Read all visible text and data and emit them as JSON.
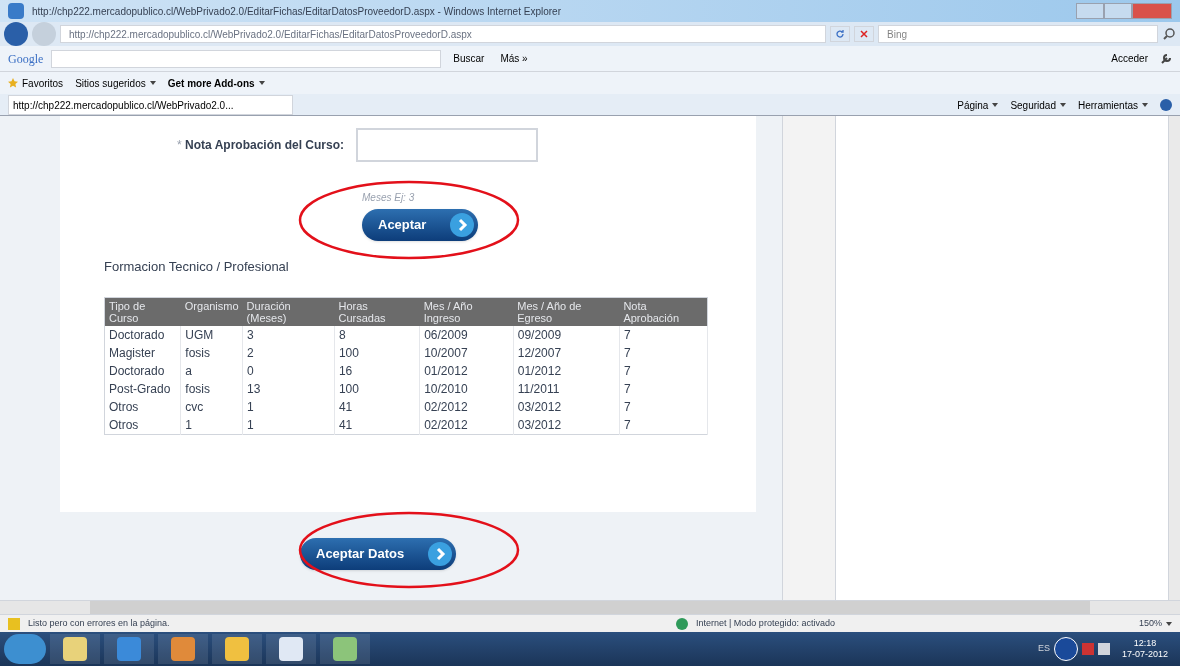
{
  "window": {
    "title": "http://chp222.mercadopublico.cl/WebPrivado2.0/EditarFichas/EditarDatosProveedorD.aspx - Windows Internet Explorer"
  },
  "address_bar": {
    "url": "http://chp222.mercadopublico.cl/WebPrivado2.0/EditarFichas/EditarDatosProveedorD.aspx",
    "search_placeholder": "Bing"
  },
  "google_bar": {
    "logo": "Google",
    "search_button": "Buscar",
    "more": "Más »",
    "sign_in": "Acceder"
  },
  "favorites_bar": {
    "favorites": "Favoritos",
    "items": [
      "Sitios sugeridos",
      "Get more Add-ons"
    ]
  },
  "tab": {
    "title": "http://chp222.mercadopublico.cl/WebPrivado2.0..."
  },
  "command_bar": [
    "Página",
    "Seguridad",
    "Herramientas"
  ],
  "form": {
    "label": "Nota Aprobación del Curso:",
    "required_mark": "*",
    "hint": "Meses Ej: 3",
    "accept_button": "Aceptar"
  },
  "section_title": "Formacion Tecnico / Profesional",
  "table": {
    "columns": [
      "Tipo de Curso",
      "Organismo",
      "Duración (Meses)",
      "Horas Cursadas",
      "Mes / Año Ingreso",
      "Mes / Año de Egreso",
      "Nota Aprobación"
    ],
    "rows": [
      [
        "Doctorado",
        "UGM",
        "3",
        "8",
        "06/2009",
        "09/2009",
        "7"
      ],
      [
        "Magister",
        "fosis",
        "2",
        "100",
        "10/2007",
        "12/2007",
        "7"
      ],
      [
        "Doctorado",
        "a",
        "0",
        "16",
        "01/2012",
        "01/2012",
        "7"
      ],
      [
        "Post-Grado",
        "fosis",
        "13",
        "100",
        "10/2010",
        "11/2011",
        "7"
      ],
      [
        "Otros",
        "cvc",
        "1",
        "41",
        "02/2012",
        "03/2012",
        "7"
      ],
      [
        "Otros",
        "1",
        "1",
        "41",
        "02/2012",
        "03/2012",
        "7"
      ]
    ]
  },
  "submit_button": "Aceptar Datos",
  "status_bar": {
    "message": "Listo pero con errores en la página.",
    "zone": "Internet | Modo protegido: activado",
    "zoom": "150%"
  },
  "taskbar": {
    "language": "ES",
    "time": "12:18",
    "date": "17-07-2012"
  }
}
